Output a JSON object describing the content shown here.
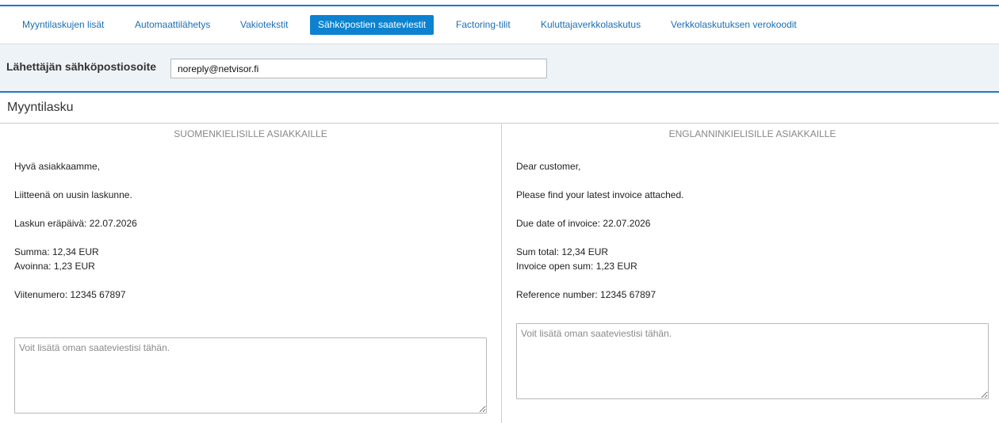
{
  "tabs": [
    {
      "label": "Myyntilaskujen lisät",
      "active": false
    },
    {
      "label": "Automaattilähetys",
      "active": false
    },
    {
      "label": "Vakiotekstit",
      "active": false
    },
    {
      "label": "Sähköpostien saateviestit",
      "active": true
    },
    {
      "label": "Factoring-tilit",
      "active": false
    },
    {
      "label": "Kuluttajaverkkolaskutus",
      "active": false
    },
    {
      "label": "Verkkolaskutuksen verokoodit",
      "active": false
    }
  ],
  "sender": {
    "label": "Lähettäjän sähköpostiosoite",
    "value": "noreply@netvisor.fi"
  },
  "section": {
    "title": "Myyntilasku"
  },
  "finnish": {
    "heading": "SUOMENKIELISILLE ASIAKKAILLE",
    "greeting": "Hyvä asiakkaamme,",
    "attached": "Liitteenä on uusin laskunne.",
    "due_date": "Laskun eräpäivä: 22.07.2026",
    "sum": "Summa: 12,34 EUR",
    "open": "Avoinna: 1,23 EUR",
    "reference": "Viitenumero: 12345 67897",
    "note_placeholder": "Voit lisätä oman saateviestisi tähän."
  },
  "english": {
    "heading": "ENGLANNINKIELISILLE ASIAKKAILLE",
    "greeting": "Dear customer,",
    "attached": "Please find your latest invoice attached.",
    "due_date": "Due date of invoice: 22.07.2026",
    "sum": "Sum total: 12,34 EUR",
    "open": "Invoice open sum: 1,23 EUR",
    "reference": "Reference number: 12345 67897",
    "note_placeholder": "Voit lisätä oman saateviestisi tähän."
  },
  "colors": {
    "accent": "#0c82d0",
    "link": "#1a6fb5",
    "sender_bg": "#eef3f7"
  }
}
